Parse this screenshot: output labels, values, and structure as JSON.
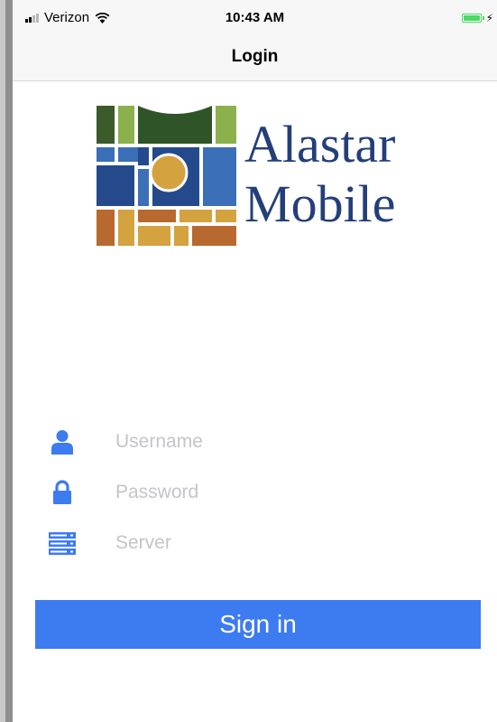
{
  "status_bar": {
    "carrier": "Verizon",
    "time": "10:43 AM",
    "battery_level": 1.0,
    "charging": true
  },
  "nav": {
    "title": "Login"
  },
  "logo": {
    "line1": "Alastar",
    "line2": "Mobile"
  },
  "form": {
    "username": {
      "placeholder": "Username",
      "icon": "user-icon",
      "value": ""
    },
    "password": {
      "placeholder": "Password",
      "icon": "lock-icon",
      "value": ""
    },
    "server": {
      "placeholder": "Server",
      "icon": "server-icon",
      "value": ""
    }
  },
  "signin": {
    "label": "Sign in"
  },
  "colors": {
    "accent": "#3d7bf0",
    "logo_text": "#233f7a",
    "placeholder": "#c4c4c9"
  }
}
